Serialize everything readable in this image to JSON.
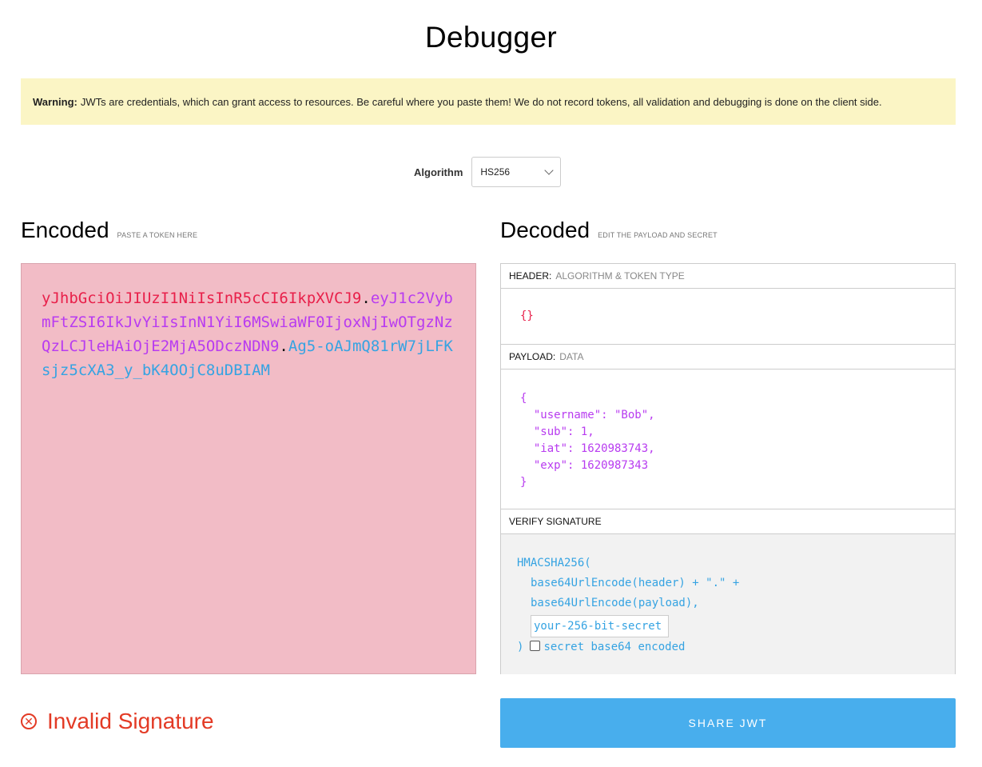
{
  "page_title": "Debugger",
  "warning": {
    "label": "Warning:",
    "text": "JWTs are credentials, which can grant access to resources. Be careful where you paste them! We do not record tokens, all validation and debugging is done on the client side."
  },
  "algorithm": {
    "label": "Algorithm",
    "selected": "HS256"
  },
  "encoded": {
    "title": "Encoded",
    "subtitle": "PASTE A TOKEN HERE",
    "token_header": "yJhbGciOiJIUzI1NiIsInR5cCI6IkpXVCJ9",
    "dot1": ".",
    "token_payload": "eyJ1c2VybmFtZSI6IkJvYiIsInN1YiI6MSwiaWF0IjoxNjIwOTgzNzQzLCJleHAiOjE2MjA5ODczNDN9",
    "dot2": ".",
    "token_signature": "Ag5-oAJmQ81rW7jLFKsjz5cXA3_y_bK4OOjC8uDBIAM"
  },
  "decoded": {
    "title": "Decoded",
    "subtitle": "EDIT THE PAYLOAD AND SECRET",
    "header_label": "HEADER:",
    "header_sub": "ALGORITHM & TOKEN TYPE",
    "header_json": "{}",
    "payload_label": "PAYLOAD:",
    "payload_sub": "DATA",
    "payload_json": "{\n  \"username\": \"Bob\",\n  \"sub\": 1,\n  \"iat\": 1620983743,\n  \"exp\": 1620987343\n}",
    "verify_label": "VERIFY SIGNATURE",
    "verify_line1": "HMACSHA256(",
    "verify_line2": "base64UrlEncode(header) + \".\" +",
    "verify_line3": "base64UrlEncode(payload),",
    "secret_value": "your-256-bit-secret",
    "close_paren": ")",
    "base64_label": "secret base64 encoded"
  },
  "status": {
    "text": "Invalid Signature",
    "icon": "error-circle-icon",
    "color": "#e33a25"
  },
  "share_button": "SHARE JWT",
  "colors": {
    "header": "#e8204a",
    "payload": "#b83bf0",
    "signature": "#35a3e2",
    "button": "#48aeed"
  }
}
